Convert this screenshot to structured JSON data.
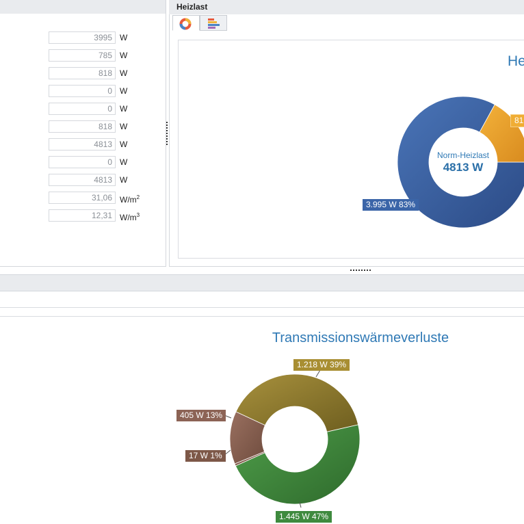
{
  "values_panel": {
    "rows": [
      {
        "value": "3995",
        "unit": "W"
      },
      {
        "value": "785",
        "unit": "W"
      },
      {
        "value": "818",
        "unit": "W"
      },
      {
        "value": "0",
        "unit": "W"
      },
      {
        "value": "0",
        "unit": "W"
      },
      {
        "value": "818",
        "unit": "W"
      },
      {
        "value": "4813",
        "unit": "W"
      },
      {
        "value": "0",
        "unit": "W"
      },
      {
        "value": "4813",
        "unit": "W"
      },
      {
        "value": "31,06",
        "unit": "W/m",
        "unit_sup": "2"
      },
      {
        "value": "12,31",
        "unit": "W/m",
        "unit_sup": "3"
      }
    ]
  },
  "heizlast_panel": {
    "title": "Heizlast",
    "tabs": [
      {
        "icon": "donut-chart-icon",
        "selected": true
      },
      {
        "icon": "bar-chart-icon",
        "selected": false
      }
    ]
  },
  "heizlast_chart": {
    "title_visible": "He",
    "center_label": "Norm-Heizlast",
    "center_value": "4813 W",
    "badges": {
      "main": "3.995 W 83%",
      "secondary": "81"
    }
  },
  "transmission_chart": {
    "title": "Transmissionswärmeverluste",
    "badges": [
      "1.218 W 39%",
      "405 W 13%",
      "17 W 1%",
      "1.445 W 47%"
    ]
  },
  "chart_data": [
    {
      "type": "pie",
      "title": "",
      "categories": [
        "",
        ""
      ],
      "values": [
        3995,
        818
      ],
      "percentages": [
        83,
        17
      ],
      "center_label": "Norm-Heizlast",
      "center_value": "4813 W",
      "colors": [
        "#3b65a8",
        "#e9a22b"
      ]
    },
    {
      "type": "pie",
      "title": "Transmissionswärmeverluste",
      "categories": [
        "",
        "",
        "",
        ""
      ],
      "values": [
        1218,
        1445,
        17,
        405
      ],
      "labels": [
        "1.218 W 39%",
        "1.445 W 47%",
        "17 W 1%",
        "405 W 13%"
      ],
      "colors": [
        "#8f7d2f",
        "#3e8a3e",
        "#7d5848",
        "#8c6355"
      ]
    }
  ]
}
